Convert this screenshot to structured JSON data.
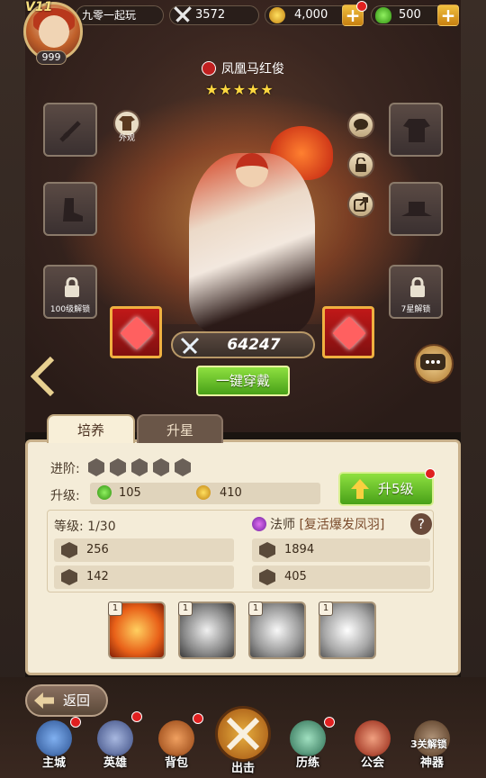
{
  "player": {
    "vip": "V11",
    "level": "999",
    "name": "九零一起玩",
    "power": "3572",
    "gold": "4,000",
    "potion": "500"
  },
  "hero": {
    "name": "凤凰马红俊",
    "stars": "★★★★★",
    "combat_power": "64247"
  },
  "slots": {
    "skin_label": "外观",
    "lock_100": "100级解锁",
    "lock_7star": "7星解锁"
  },
  "buttons": {
    "equip_all": "一键穿戴",
    "upgrade": "升5级",
    "back": "返回"
  },
  "tabs": [
    "培养",
    "升星"
  ],
  "panel": {
    "advance_label": "进阶:",
    "upgrade_label": "升级:",
    "cost_potion": "105",
    "cost_gold": "410",
    "level_text": "等级: 1/30",
    "class_name": "法师",
    "class_skill": "[复活爆发凤羽]",
    "help": "?",
    "stats": [
      "256",
      "1894",
      "142",
      "405"
    ]
  },
  "skills": [
    {
      "level": "1",
      "color": "#e86018"
    },
    {
      "level": "1",
      "color": "#9a9a9a"
    },
    {
      "level": "1",
      "color": "#a8a8a8"
    },
    {
      "level": "1",
      "color": "#b8b8b8"
    }
  ],
  "nav": [
    {
      "label": "主城",
      "icon": "castle-icon",
      "color": "#4a80c8"
    },
    {
      "label": "英雄",
      "icon": "helmet-icon",
      "color": "#6a7ab0"
    },
    {
      "label": "背包",
      "icon": "backpack-icon",
      "color": "#c07030"
    },
    {
      "label": "出击",
      "icon": "crossed-swords-icon",
      "color": "#d09030"
    },
    {
      "label": "历练",
      "icon": "training-icon",
      "color": "#60a080"
    },
    {
      "label": "公会",
      "icon": "guild-icon",
      "color": "#d04030"
    },
    {
      "label": "神器",
      "icon": "artifact-icon",
      "color": "#a07050"
    }
  ],
  "nav_lock": "3关解锁"
}
